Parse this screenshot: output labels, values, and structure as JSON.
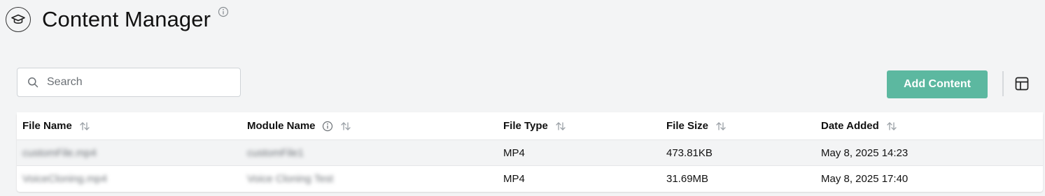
{
  "header": {
    "title": "Content Manager"
  },
  "search": {
    "placeholder": "Search"
  },
  "toolbar": {
    "add_label": "Add Content"
  },
  "table": {
    "columns": [
      "File Name",
      "Module Name",
      "File Type",
      "File Size",
      "Date Added"
    ],
    "rows": [
      {
        "file_name": "customFile.mp4",
        "module_name": "customFile1",
        "file_type": "MP4",
        "file_size": "473.81KB",
        "date_added": "May 8, 2025 14:23"
      },
      {
        "file_name": "VoiceCloning.mp4",
        "module_name": "Voice Cloning Test",
        "file_type": "MP4",
        "file_size": "31.69MB",
        "date_added": "May 8, 2025 17:40"
      }
    ]
  },
  "colors": {
    "accent": "#5cb8a0",
    "background": "#f3f4f5"
  },
  "icons": {
    "app": "graduation-cap-icon",
    "info": "info-icon",
    "search": "search-icon",
    "sort": "sort-icon",
    "columns": "table-columns-icon"
  }
}
